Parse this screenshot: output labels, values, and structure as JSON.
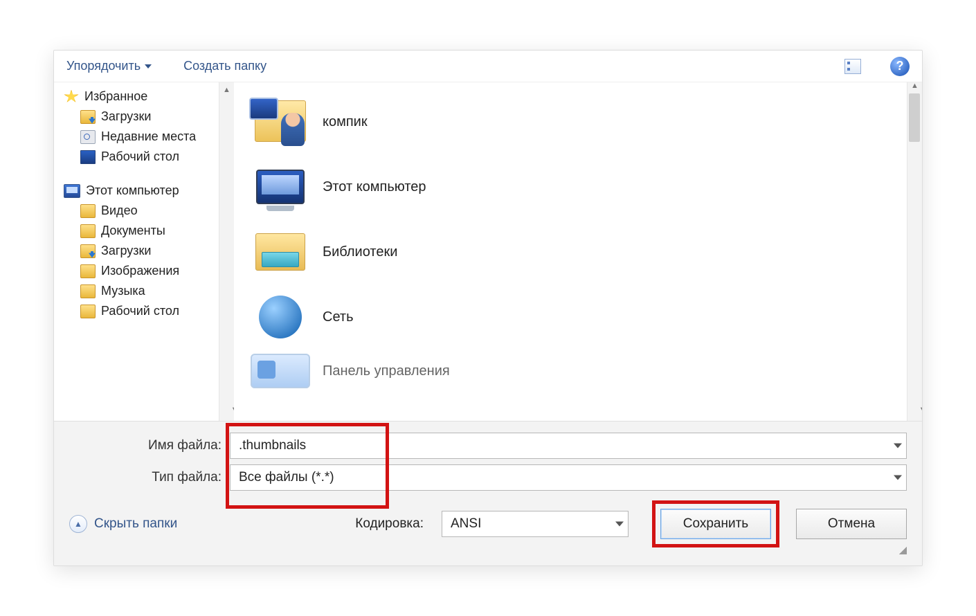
{
  "toolbar": {
    "organize": "Упорядочить",
    "new_folder": "Создать папку"
  },
  "sidebar": {
    "favorites": {
      "label": "Избранное",
      "items": [
        "Загрузки",
        "Недавние места",
        "Рабочий стол"
      ]
    },
    "computer": {
      "label": "Этот компьютер",
      "items": [
        "Видео",
        "Документы",
        "Загрузки",
        "Изображения",
        "Музыка",
        "Рабочий стол"
      ]
    }
  },
  "main": {
    "items": [
      "компик",
      "Этот компьютер",
      "Библиотеки",
      "Сеть",
      "Панель управления"
    ]
  },
  "form": {
    "filename_label": "Имя файла:",
    "filename_value": ".thumbnails",
    "filetype_label": "Тип файла:",
    "filetype_value": "Все файлы  (*.*)",
    "encoding_label": "Кодировка:",
    "encoding_value": "ANSI",
    "hide_folders": "Скрыть папки",
    "save": "Сохранить",
    "cancel": "Отмена"
  }
}
